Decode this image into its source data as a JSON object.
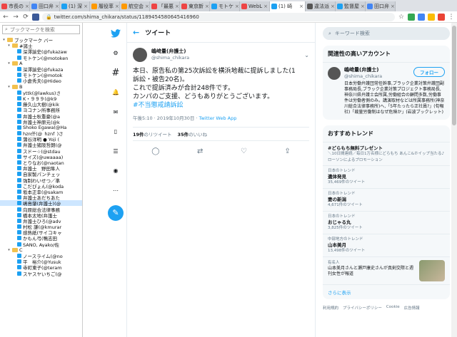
{
  "tabs": [
    {
      "label": "市長の"
    },
    {
      "label": "田口弁"
    },
    {
      "label": "(1) 深"
    },
    {
      "label": "履役率"
    },
    {
      "label": "航空会"
    },
    {
      "label": "「最悪"
    },
    {
      "label": "東京新"
    },
    {
      "label": "モトケ"
    },
    {
      "label": "WebL"
    },
    {
      "label": "(1) 崎"
    },
    {
      "label": "違法派"
    },
    {
      "label": "監督屋"
    },
    {
      "label": "田口弁"
    }
  ],
  "toolbar": {
    "url": "twitter.com/shima_chikara/status/1189454580645416960"
  },
  "sidebar": {
    "search_placeholder": "ブックマークを検索",
    "rows": [
      {
        "label": "ブックマーク バー",
        "kind": "folder",
        "indent": 0,
        "twist": "▾"
      },
      {
        "label": "#諸士",
        "kind": "folder",
        "indent": 1,
        "twist": "▾"
      },
      {
        "label": "深澤諭史(@fukazaw",
        "kind": "bm",
        "indent": 2,
        "twist": ""
      },
      {
        "label": "モトケン(@motoken_",
        "kind": "bm",
        "indent": 2,
        "twist": ""
      },
      {
        "label": "A",
        "kind": "folder",
        "indent": 1,
        "twist": "▾"
      },
      {
        "label": "深澤諭史(@fukaza",
        "kind": "bm",
        "indent": 2,
        "twist": ""
      },
      {
        "label": "モトケン(@motok",
        "kind": "bm",
        "indent": 2,
        "twist": ""
      },
      {
        "label": "小倉秀夫(@Hideo",
        "kind": "bm",
        "indent": 2,
        "twist": ""
      },
      {
        "label": "B",
        "kind": "folder",
        "indent": 1,
        "twist": "▾"
      },
      {
        "label": "yttk(@lawkus)さ",
        "kind": "bm",
        "indent": 2,
        "twist": ""
      },
      {
        "label": "K・９９９(@k9",
        "kind": "bm",
        "indent": 2,
        "twist": ""
      },
      {
        "label": "藤久山大樹(@kik",
        "kind": "bm",
        "indent": 2,
        "twist": ""
      },
      {
        "label": "ヨコナン所事務所",
        "kind": "bm",
        "indent": 2,
        "twist": ""
      },
      {
        "label": "弁護士秋重豪(@a",
        "kind": "bm",
        "indent": 2,
        "twist": ""
      },
      {
        "label": "弁護士神原元(@k",
        "kind": "bm",
        "indent": 2,
        "twist": ""
      },
      {
        "label": "Shoko Egawa(@Ha",
        "kind": "bm",
        "indent": 2,
        "twist": ""
      },
      {
        "label": "hzn仟(@_hznf_)さ",
        "kind": "bm",
        "indent": 2,
        "twist": ""
      },
      {
        "label": "蒲谷洋明 ● Yoji (",
        "kind": "bm",
        "indent": 2,
        "twist": ""
      },
      {
        "label": "弁護士猪阪哲朗(@",
        "kind": "bm",
        "indent": 2,
        "twist": ""
      },
      {
        "label": "スドー☆(@stdau",
        "kind": "bm",
        "indent": 2,
        "twist": ""
      },
      {
        "label": "サイズ(@uwaaaa)",
        "kind": "bm",
        "indent": 2,
        "twist": ""
      },
      {
        "label": "とりなお(@naotan",
        "kind": "bm",
        "indent": 2,
        "twist": ""
      },
      {
        "label": "弁護士　野田隼人",
        "kind": "bm",
        "indent": 2,
        "twist": ""
      },
      {
        "label": "自家製パンチェッ",
        "kind": "bm",
        "indent": 2,
        "twist": ""
      },
      {
        "label": "強制わいせつ／準",
        "kind": "bm",
        "indent": 2,
        "twist": ""
      },
      {
        "label": "こだぴょん(@koda",
        "kind": "bm",
        "indent": 2,
        "twist": ""
      },
      {
        "label": "坂本正幸(@sakam",
        "kind": "bm",
        "indent": 2,
        "twist": ""
      },
      {
        "label": "弁護士あだちあた",
        "kind": "bm",
        "indent": 2,
        "twist": ""
      },
      {
        "label": "嶋島肇(弁護士)(@",
        "kind": "bm",
        "indent": 2,
        "twist": "",
        "selected": true
      },
      {
        "label": "向原総合法律事務",
        "kind": "bm",
        "indent": 2,
        "twist": ""
      },
      {
        "label": "橋本太地(弁護士",
        "kind": "bm",
        "indent": 2,
        "twist": ""
      },
      {
        "label": "弁護士ひろ(@adv",
        "kind": "bm",
        "indent": 2,
        "twist": ""
      },
      {
        "label": "村松 謙(@kmurar",
        "kind": "bm",
        "indent": 2,
        "twist": ""
      },
      {
        "label": "感熱紙(サイコキャ",
        "kind": "bm",
        "indent": 2,
        "twist": ""
      },
      {
        "label": "かもん弓(鴨志田",
        "kind": "bm",
        "indent": 2,
        "twist": ""
      },
      {
        "label": "SANO, Ayako/佐",
        "kind": "bm",
        "indent": 2,
        "twist": ""
      },
      {
        "label": "C",
        "kind": "folder",
        "indent": 1,
        "twist": "▾"
      },
      {
        "label": "ノースライム(@no",
        "kind": "bm",
        "indent": 2,
        "twist": ""
      },
      {
        "label": "平　裕介(@Yusuk",
        "kind": "bm",
        "indent": 2,
        "twist": ""
      },
      {
        "label": "寺町東子(@teram",
        "kind": "bm",
        "indent": 2,
        "twist": ""
      },
      {
        "label": "スヤスヤいちご(@",
        "kind": "bm",
        "indent": 2,
        "twist": ""
      }
    ]
  },
  "main": {
    "header_title": "ツイート",
    "author": {
      "display_name": "嶋﨑量(弁護士)",
      "username": "@shima_chikara"
    },
    "text_line1": "本日、原告私の第25次訴訟を横浜地裁に提訴しました(1",
    "text_line2": "訴訟・被告20名)。",
    "text_line3": "これで提訴済みが合計248件です。",
    "text_line4": "カンパのご支援、どうもありがとうございます。",
    "hashtag": "#不当懲戒請訴訟",
    "time": "午後5:10 · 2019年10月30日 · ",
    "client": "Twitter Web App",
    "retweets_count": "19件",
    "retweets_label": "のリツイート",
    "likes_count": "35件",
    "likes_label": "のいいね"
  },
  "right": {
    "search_placeholder": "キーワード検索",
    "related_title": "関連性の高いアカウント",
    "account": {
      "display_name": "嶋﨑量(弁護士)",
      "username": "@shima_chikara",
      "follow_label": "フォロー",
      "bio": "日本労働弁護団常任幹事,ブラック企業対策弁護団副事務局長,ブラック企業対策プロジェクト事務局長,神奈川県弁護士会所属,労働組合の顧問多数,労働事件は労働者側のみ。講演取材などは所属事務所(神奈川総合法律事務所)へ,「5年たったら正社員?」(旬報社)「裁量労働制はなぜ危険か」(岩波ブックレット)"
    },
    "trends_title": "おすすめトレンド",
    "trends": [
      {
        "ctx": "",
        "title": "#どらもち無料プレゼント",
        "sub": "＼10日間連続／毎日1万名様にどらもち あんこ&ホイップ当たる♪",
        "promo": "ローソンによるプロモーション"
      },
      {
        "ctx": "日本のトレンド",
        "title": "遺体発見",
        "sub": "35,469件のツイート"
      },
      {
        "ctx": "日本のトレンド",
        "title": "妻の新潟",
        "sub": "4,671件のツイート"
      },
      {
        "ctx": "日本のトレンド",
        "title": "おじゃる丸",
        "sub": "3,825件のツイート"
      },
      {
        "ctx": "中部地方のトレンド",
        "title": "山本美月",
        "sub": "13,498件のツイート"
      }
    ],
    "news": {
      "ctx": "有名人",
      "text": "山本美月さんと瀬戸康史さんが真剣交際と週刊女性が報道"
    },
    "more_label": "さらに表示",
    "footer": [
      "利用規約",
      "プライバシーポリシー",
      "Cookie",
      "広告情報"
    ]
  }
}
